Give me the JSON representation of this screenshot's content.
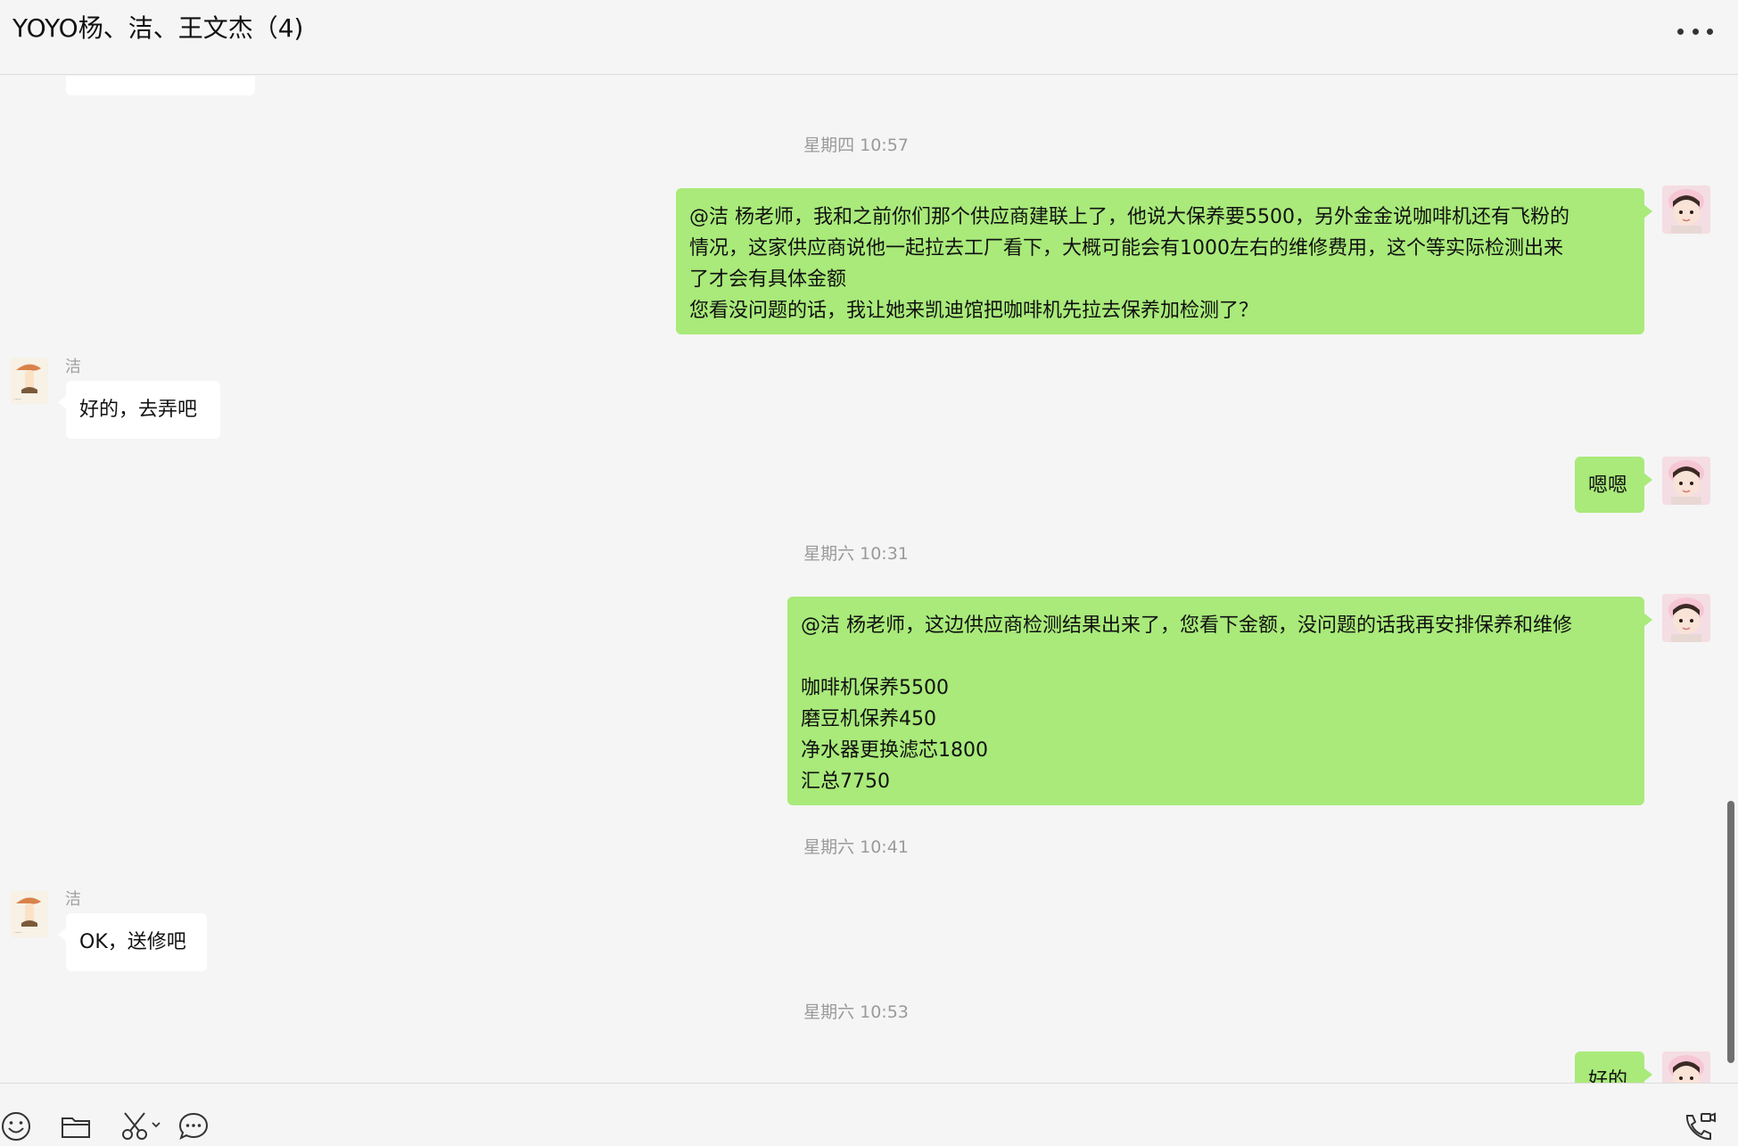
{
  "header": {
    "title": "YOYO杨、洁、王文杰（4)",
    "more_icon": "more-horizontal-icon"
  },
  "messages": [
    {
      "type": "partial-top"
    },
    {
      "type": "time",
      "text": "星期四 10:57"
    },
    {
      "type": "message",
      "side": "me",
      "lines": [
        "@洁 杨老师，我和之前你们那个供应商建联上了，他说大保养要5500，另外金金说咖啡机还有飞粉的",
        "情况，这家供应商说他一起拉去工厂看下，大概可能会有1000左右的维修费用，这个等实际检测出来",
        "了才会有具体金额",
        "您看没问题的话，我让她来凯迪馆把咖啡机先拉去保养加检测了？"
      ]
    },
    {
      "type": "message",
      "side": "them",
      "sender": "洁",
      "lines": [
        "好的，去弄吧"
      ]
    },
    {
      "type": "message",
      "side": "me",
      "lines": [
        "嗯嗯"
      ]
    },
    {
      "type": "time",
      "text": "星期六 10:31"
    },
    {
      "type": "message",
      "side": "me",
      "lines": [
        "@洁 杨老师，这边供应商检测结果出来了，您看下金额，没问题的话我再安排保养和维修",
        "",
        "咖啡机保养5500",
        "磨豆机保养450",
        "净水器更换滤芯1800",
        "汇总7750"
      ]
    },
    {
      "type": "time",
      "text": "星期六 10:41"
    },
    {
      "type": "message",
      "side": "them",
      "sender": "洁",
      "lines": [
        "OK，送修吧"
      ]
    },
    {
      "type": "time",
      "text": "星期六 10:53"
    },
    {
      "type": "message",
      "side": "me",
      "lines": [
        "好的"
      ]
    }
  ],
  "toolbar": {
    "icons": [
      "emoji-icon",
      "folder-icon",
      "scissors-icon",
      "chat-bubble-icon",
      "video-call-icon"
    ]
  },
  "colors": {
    "my_bubble": "#a9ea7a",
    "their_bubble": "#ffffff",
    "background": "#f5f5f5",
    "timestamp": "#9a9a9a"
  }
}
